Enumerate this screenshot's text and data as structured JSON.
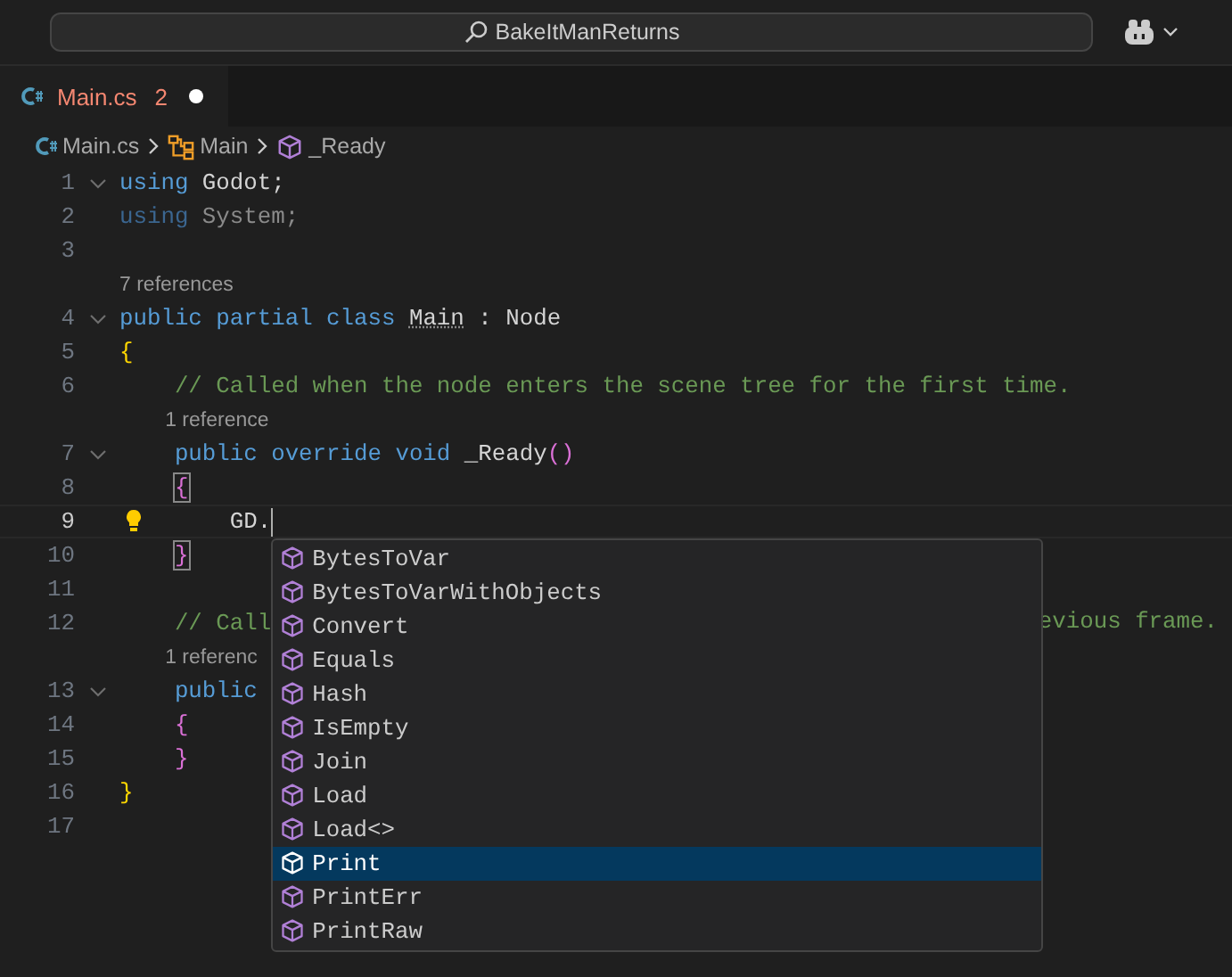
{
  "titlebar": {
    "search_text": "BakeItManReturns"
  },
  "tabs": [
    {
      "label": "Main.cs",
      "problems": "2",
      "modified": true,
      "selected": true
    }
  ],
  "breadcrumb": [
    {
      "kind": "file",
      "label": "Main.cs"
    },
    {
      "kind": "class",
      "label": "Main"
    },
    {
      "kind": "method",
      "label": "_Ready"
    }
  ],
  "lines": [
    {
      "number": "1",
      "kind": "top",
      "fold": true,
      "current": false,
      "tokens": [
        {
          "kind": "kw",
          "text": "using"
        },
        {
          "kind": "text",
          "text": " Godot;"
        }
      ]
    },
    {
      "number": "2",
      "kind": "top",
      "fold": false,
      "current": false,
      "tokens": [
        {
          "kind": "kw-faded",
          "text": "using"
        },
        {
          "kind": "text-faded",
          "text": " System;"
        }
      ]
    },
    {
      "number": "3",
      "kind": "top",
      "fold": false,
      "current": false
    },
    {
      "number": "4",
      "kind": "top",
      "fold": true,
      "current": false,
      "codelens": "7 references",
      "tokens": [
        {
          "kind": "kw",
          "text": "public partial class "
        },
        {
          "kind": "type",
          "text": "Main"
        },
        {
          "kind": "text",
          "text": " : Node"
        }
      ]
    },
    {
      "number": "5",
      "kind": "top",
      "fold": false,
      "current": false,
      "tokens": [
        {
          "kind": "brace-gold",
          "text": "{"
        }
      ]
    },
    {
      "number": "6",
      "kind": "member",
      "fold": false,
      "current": false,
      "tokens": [
        {
          "kind": "comment",
          "text": "// Called when the node enters the scene tree for the first time."
        }
      ]
    },
    {
      "number": "7",
      "kind": "member",
      "fold": true,
      "current": false,
      "codelens": "1 reference",
      "tokens": [
        {
          "kind": "kw",
          "text": "public override void"
        },
        {
          "kind": "text",
          "text": " _Ready"
        },
        {
          "kind": "brace-orchid",
          "text": "()"
        }
      ]
    },
    {
      "number": "8",
      "kind": "member",
      "fold": false,
      "current": false,
      "tokens": [
        {
          "kind": "brace-match",
          "text": "{"
        }
      ]
    },
    {
      "number": "9",
      "kind": "body",
      "fold": false,
      "current": true,
      "tokens": [
        {
          "kind": "text",
          "text": "GD."
        }
      ]
    },
    {
      "number": "10",
      "kind": "member",
      "fold": false,
      "current": false,
      "tokens": [
        {
          "kind": "brace-match",
          "text": "}"
        }
      ]
    },
    {
      "number": "11",
      "kind": "top",
      "fold": false,
      "current": false
    },
    {
      "number": "12",
      "kind": "member",
      "fold": false,
      "current": false,
      "tokens": [
        {
          "kind": "comment",
          "text": "// Call"
        }
      ],
      "tail": "evious frame."
    },
    {
      "number": "13",
      "kind": "member",
      "fold": true,
      "current": false,
      "codelens": "1 referenc",
      "tokens": [
        {
          "kind": "kw",
          "text": "public"
        }
      ]
    },
    {
      "number": "14",
      "kind": "member",
      "fold": false,
      "current": false,
      "tokens": [
        {
          "kind": "brace-orchid",
          "text": "{"
        }
      ]
    },
    {
      "number": "15",
      "kind": "member",
      "fold": false,
      "current": false,
      "tokens": [
        {
          "kind": "brace-orchid",
          "text": "}"
        }
      ]
    },
    {
      "number": "16",
      "kind": "top",
      "fold": false,
      "current": false,
      "tokens": [
        {
          "kind": "brace-gold",
          "text": "}"
        }
      ]
    },
    {
      "number": "17",
      "kind": "top",
      "fold": false,
      "current": false
    }
  ],
  "suggestions": [
    {
      "label": "BytesToVar",
      "selected": false
    },
    {
      "label": "BytesToVarWithObjects",
      "selected": false
    },
    {
      "label": "Convert",
      "selected": false
    },
    {
      "label": "Equals",
      "selected": false
    },
    {
      "label": "Hash",
      "selected": false
    },
    {
      "label": "IsEmpty",
      "selected": false
    },
    {
      "label": "Join",
      "selected": false
    },
    {
      "label": "Load",
      "selected": false
    },
    {
      "label": "Load<>",
      "selected": false
    },
    {
      "label": "Print",
      "selected": true
    },
    {
      "label": "PrintErr",
      "selected": false
    },
    {
      "label": "PrintRaw",
      "selected": false
    }
  ]
}
